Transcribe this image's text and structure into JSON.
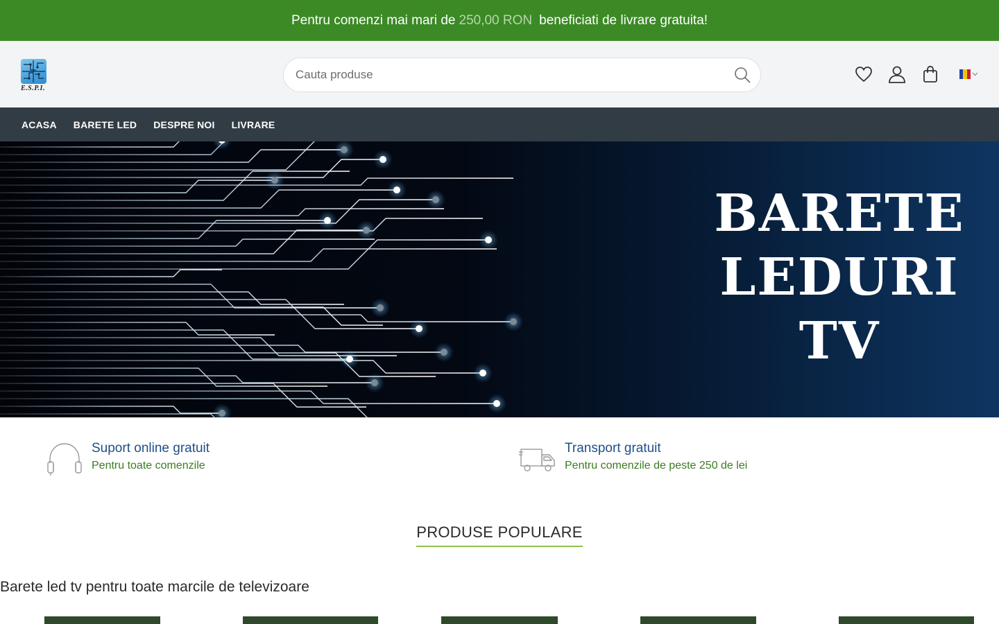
{
  "promo": {
    "text_before": "Pentru comenzi mai mari de",
    "amount": "250,00 RON",
    "text_after": "beneficiati de livrare gratuita!"
  },
  "logo": {
    "text": "E.S.P.I."
  },
  "search": {
    "placeholder": "Cauta produse"
  },
  "header_icons": [
    "heart-icon",
    "user-icon",
    "cart-icon"
  ],
  "language": {
    "flag": "RO"
  },
  "nav": {
    "items": [
      "ACASA",
      "BARETE LED",
      "DESPRE NOI",
      "LIVRARE"
    ]
  },
  "hero": {
    "line1": "BARETE",
    "line2": "LEDURI",
    "line3": "TV"
  },
  "features": [
    {
      "title": "Suport online gratuit",
      "subtitle": "Pentru toate comenzile",
      "icon": "headphones-icon"
    },
    {
      "title": "Transport gratuit",
      "subtitle": "Pentru comenzile de peste 250 de lei",
      "icon": "truck-icon"
    }
  ],
  "section": {
    "title": "PRODUSE POPULARE",
    "subtitle": "Barete led tv pentru toate marcile de televizoare"
  },
  "colors": {
    "promo_bg": "#3b8a26",
    "nav_bg": "#323c44",
    "accent_green": "#8bc34a",
    "link_blue": "#1e4f8a"
  }
}
